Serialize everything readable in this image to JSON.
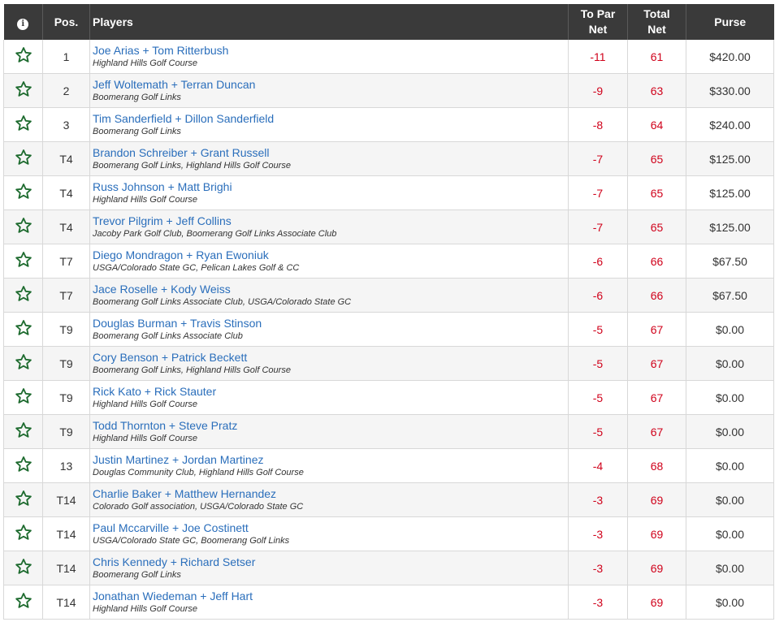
{
  "header": {
    "info_glyph": "i",
    "pos": "Pos.",
    "players": "Players",
    "to_par_net_line1": "To Par",
    "to_par_net_line2": "Net",
    "total_net_line1": "Total",
    "total_net_line2": "Net",
    "purse": "Purse"
  },
  "colors": {
    "header_bg": "#3a3a3a",
    "player_link": "#2a6ebb",
    "score_red": "#d0021b",
    "star_green": "#1e6b2f"
  },
  "rows": [
    {
      "pos": "1",
      "players": "Joe Arias + Tom Ritterbush",
      "courses": "Highland Hills Golf Course",
      "to_par": "-11",
      "total": "61",
      "purse": "$420.00"
    },
    {
      "pos": "2",
      "players": "Jeff Woltemath + Terran Duncan",
      "courses": "Boomerang Golf Links",
      "to_par": "-9",
      "total": "63",
      "purse": "$330.00"
    },
    {
      "pos": "3",
      "players": "Tim Sanderfield + Dillon Sanderfield",
      "courses": "Boomerang Golf Links",
      "to_par": "-8",
      "total": "64",
      "purse": "$240.00"
    },
    {
      "pos": "T4",
      "players": "Brandon Schreiber + Grant Russell",
      "courses": "Boomerang Golf Links, Highland Hills Golf Course",
      "to_par": "-7",
      "total": "65",
      "purse": "$125.00"
    },
    {
      "pos": "T4",
      "players": "Russ Johnson + Matt Brighi",
      "courses": "Highland Hills Golf Course",
      "to_par": "-7",
      "total": "65",
      "purse": "$125.00"
    },
    {
      "pos": "T4",
      "players": "Trevor Pilgrim + Jeff Collins",
      "courses": "Jacoby Park Golf Club, Boomerang Golf Links Associate Club",
      "to_par": "-7",
      "total": "65",
      "purse": "$125.00"
    },
    {
      "pos": "T7",
      "players": "Diego Mondragon + Ryan Ewoniuk",
      "courses": "USGA/Colorado State GC, Pelican Lakes Golf & CC",
      "to_par": "-6",
      "total": "66",
      "purse": "$67.50"
    },
    {
      "pos": "T7",
      "players": "Jace Roselle + Kody Weiss",
      "courses": "Boomerang Golf Links Associate Club, USGA/Colorado State GC",
      "to_par": "-6",
      "total": "66",
      "purse": "$67.50"
    },
    {
      "pos": "T9",
      "players": "Douglas Burman + Travis Stinson",
      "courses": "Boomerang Golf Links Associate Club",
      "to_par": "-5",
      "total": "67",
      "purse": "$0.00"
    },
    {
      "pos": "T9",
      "players": "Cory Benson + Patrick Beckett",
      "courses": "Boomerang Golf Links, Highland Hills Golf Course",
      "to_par": "-5",
      "total": "67",
      "purse": "$0.00"
    },
    {
      "pos": "T9",
      "players": "Rick Kato + Rick Stauter",
      "courses": "Highland Hills Golf Course",
      "to_par": "-5",
      "total": "67",
      "purse": "$0.00"
    },
    {
      "pos": "T9",
      "players": "Todd Thornton + Steve Pratz",
      "courses": "Highland Hills Golf Course",
      "to_par": "-5",
      "total": "67",
      "purse": "$0.00"
    },
    {
      "pos": "13",
      "players": "Justin Martinez + Jordan Martinez",
      "courses": "Douglas Community Club, Highland Hills Golf Course",
      "to_par": "-4",
      "total": "68",
      "purse": "$0.00"
    },
    {
      "pos": "T14",
      "players": "Charlie Baker + Matthew Hernandez",
      "courses": "Colorado Golf association, USGA/Colorado State GC",
      "to_par": "-3",
      "total": "69",
      "purse": "$0.00"
    },
    {
      "pos": "T14",
      "players": "Paul Mccarville + Joe Costinett",
      "courses": "USGA/Colorado State GC, Boomerang Golf Links",
      "to_par": "-3",
      "total": "69",
      "purse": "$0.00"
    },
    {
      "pos": "T14",
      "players": "Chris Kennedy + Richard Setser",
      "courses": "Boomerang Golf Links",
      "to_par": "-3",
      "total": "69",
      "purse": "$0.00"
    },
    {
      "pos": "T14",
      "players": "Jonathan Wiedeman + Jeff Hart",
      "courses": "Highland Hills Golf Course",
      "to_par": "-3",
      "total": "69",
      "purse": "$0.00"
    }
  ]
}
